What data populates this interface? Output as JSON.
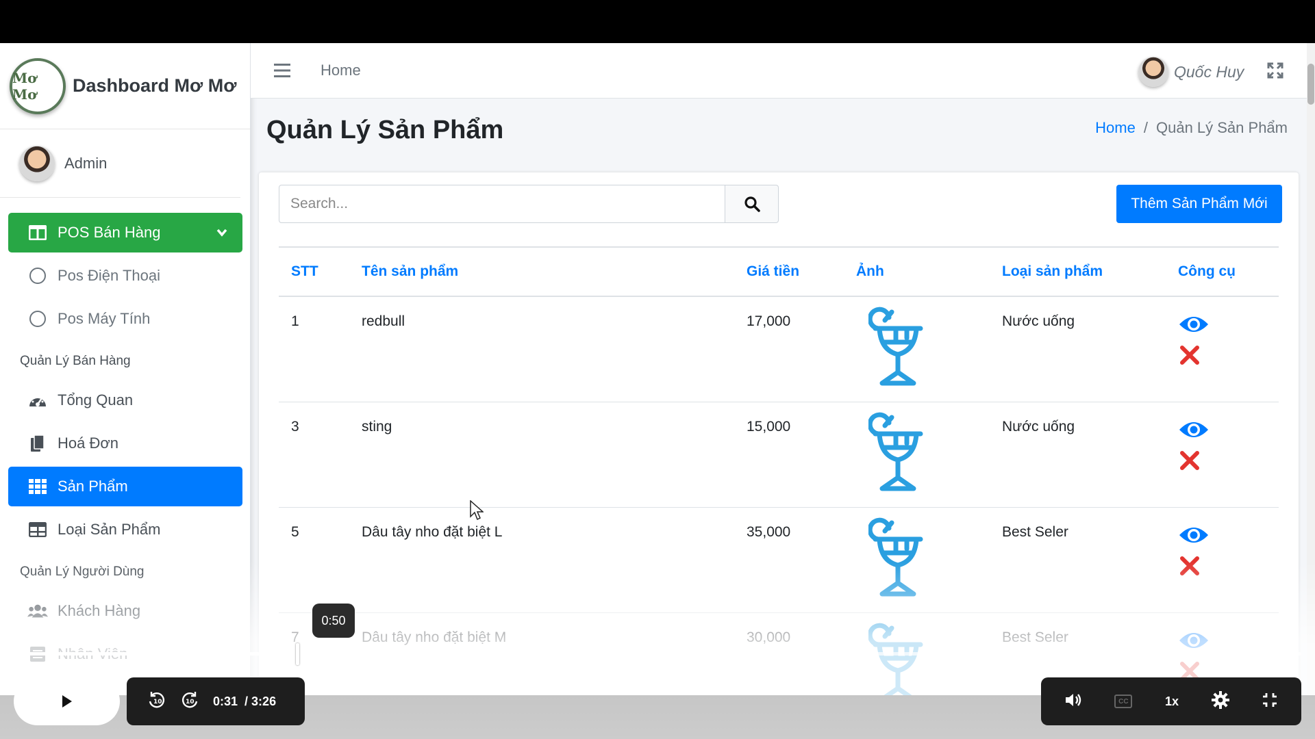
{
  "brand": {
    "title": "Dashboard Mơ Mơ",
    "logo_text": "Mơ Mơ"
  },
  "user": {
    "name": "Admin"
  },
  "sidebar": {
    "pos": {
      "label": "POS Bán Hàng",
      "items": [
        "Pos Điện Thoại",
        "Pos Máy Tính"
      ]
    },
    "section_sales": "Quản Lý Bán Hàng",
    "items_sales": [
      "Tổng Quan",
      "Hoá Đơn",
      "Sản Phẩm",
      "Loại Sản Phẩm"
    ],
    "section_users": "Quản Lý Người Dùng",
    "items_users": [
      "Khách Hàng",
      "Nhân Viên"
    ]
  },
  "topbar": {
    "home": "Home",
    "user_name": "Quốc Huy"
  },
  "page": {
    "title": "Quản Lý Sản Phẩm",
    "breadcrumb": {
      "home": "Home",
      "sep": "/",
      "current": "Quản Lý Sản Phẩm"
    },
    "search_placeholder": "Search...",
    "add_button": "Thêm Sản Phẩm Mới"
  },
  "table": {
    "headers": [
      "STT",
      "Tên sản phẩm",
      "Giá tiền",
      "Ảnh",
      "Loại sản phẩm",
      "Công cụ"
    ],
    "rows": [
      {
        "stt": "1",
        "name": "redbull",
        "price": "17,000",
        "category": "Nước uống"
      },
      {
        "stt": "3",
        "name": "sting",
        "price": "15,000",
        "category": "Nước uống"
      },
      {
        "stt": "5",
        "name": "Dâu tây nho đặt biệt L",
        "price": "35,000",
        "category": "Best Seler"
      },
      {
        "stt": "7",
        "name": "Dâu tây nho đặt biệt M",
        "price": "30,000",
        "category": "Best Seler"
      }
    ]
  },
  "player": {
    "tooltip": "0:50",
    "current_time": "0:31",
    "duration": "/ 3:26",
    "speed": "1x",
    "progress": 0.22,
    "cc": "CC"
  },
  "colors": {
    "primary": "#007bff",
    "success": "#28a745",
    "danger": "#e3342f",
    "icon": "#2a9fe0"
  }
}
